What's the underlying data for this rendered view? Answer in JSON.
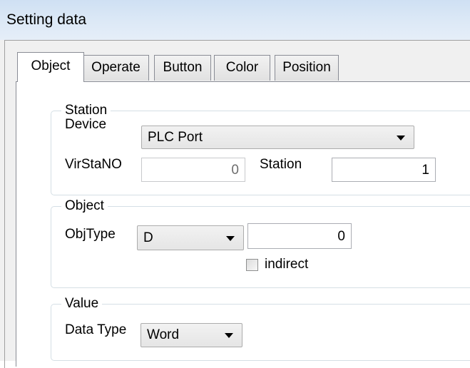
{
  "window": {
    "title": "Setting data"
  },
  "tabs": [
    {
      "label": "Object",
      "active": true
    },
    {
      "label": "Operate",
      "active": false
    },
    {
      "label": "Button",
      "active": false
    },
    {
      "label": "Color",
      "active": false
    },
    {
      "label": "Position",
      "active": false
    }
  ],
  "station_group": {
    "label": "Station",
    "device_label": "Device",
    "device_value": "PLC Port",
    "virstano_label": "VirStaNO",
    "virstano_value": "0",
    "station_label": "Station",
    "station_value": "1"
  },
  "object_group": {
    "label": "Object",
    "objtype_label": "ObjType",
    "objtype_value": "D",
    "address_value": "0",
    "indirect_label": "indirect",
    "indirect_checked": false
  },
  "value_group": {
    "label": "Value",
    "datatype_label": "Data Type",
    "datatype_value": "Word"
  }
}
